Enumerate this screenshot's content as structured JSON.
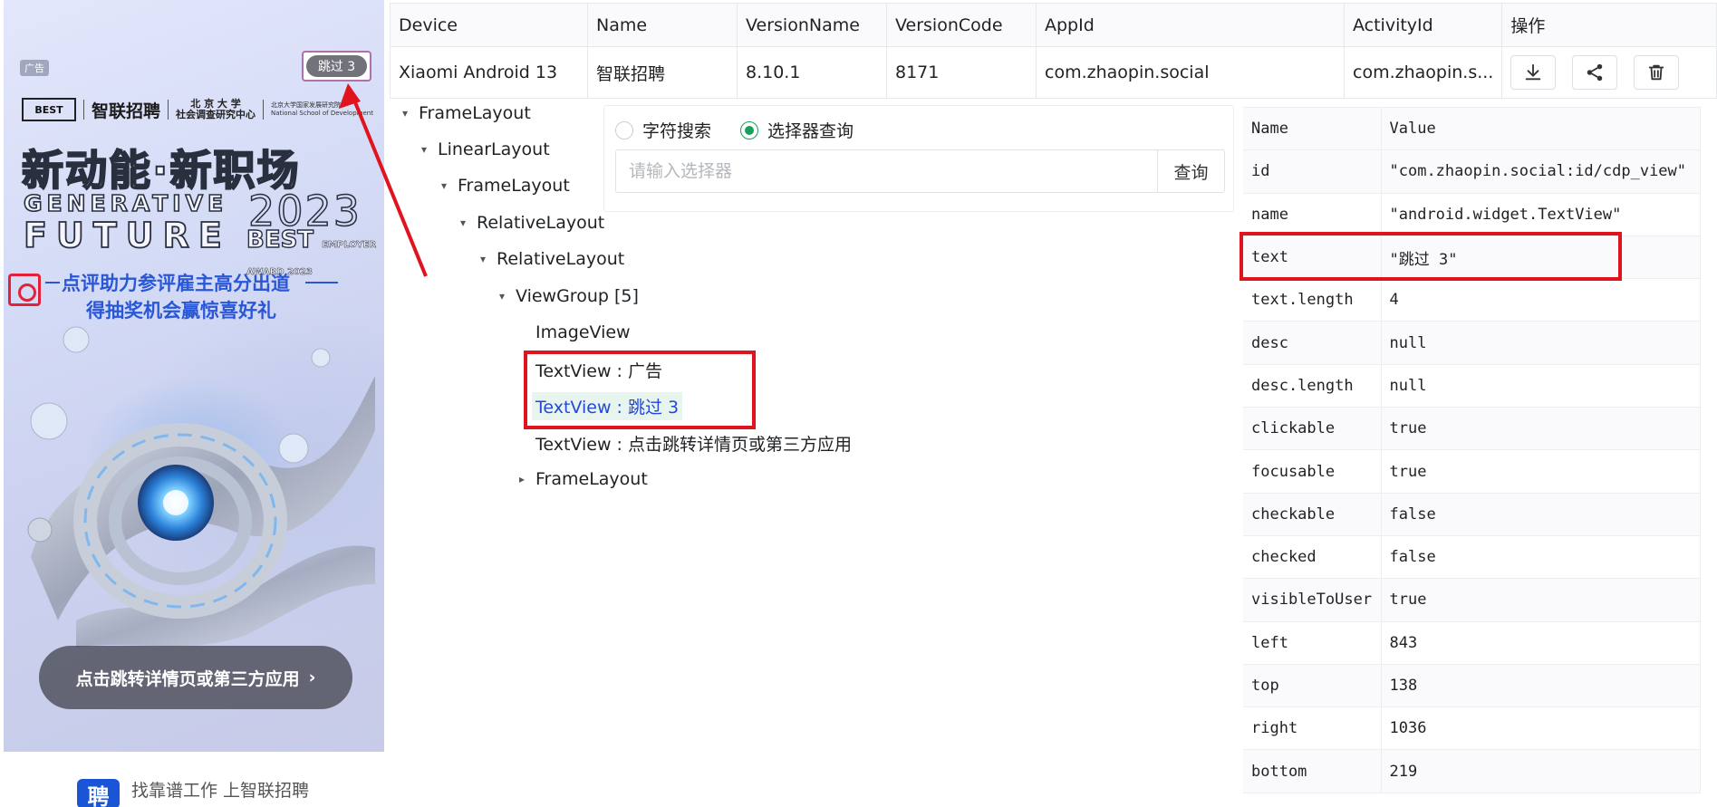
{
  "phone": {
    "ad_tag": "广告",
    "skip_label": "跳过 3",
    "logos": {
      "best": "BEST",
      "zhaopin": "智联招聘",
      "pku_line1": "北 京 大 学",
      "pku_line2": "社会调查研究中心",
      "nsd_line1": "北京大学国家发展研究院",
      "nsd_line2": "National School of Development"
    },
    "headline": "新动能·新职场",
    "line_generative": "GENERATIVE",
    "line_future": "FUTURE",
    "year": "2023",
    "best_award": "BEST",
    "best_award_sub": "EMPLOYER AWARD 2023",
    "promo_line1": "点评助力参评雇主高分出道",
    "promo_line2": "得抽奖机会赢惊喜好礼",
    "cta_label": "点击跳转详情页或第三方应用",
    "cta_arrow": "›",
    "app_icon_char": "聘",
    "slogan": "找靠谱工作  上智联招聘"
  },
  "device_table": {
    "headers": [
      "Device",
      "Name",
      "VersionName",
      "VersionCode",
      "AppId",
      "ActivityId",
      "操作"
    ],
    "row": [
      "Xiaomi Android 13",
      "智联招聘",
      "8.10.1",
      "8171",
      "com.zhaopin.social",
      "com.zhaopin.s..."
    ],
    "icons": [
      "download-icon",
      "share-icon",
      "trash-icon"
    ]
  },
  "tree": {
    "nodes": [
      {
        "label": "FrameLayout",
        "caret": "▾"
      },
      {
        "label": "LinearLayout",
        "caret": "▾"
      },
      {
        "label": "FrameLayout",
        "caret": "▾"
      },
      {
        "label": "RelativeLayout",
        "caret": "▾"
      },
      {
        "label": "RelativeLayout",
        "caret": "▾"
      },
      {
        "label": "ViewGroup [5]",
        "caret": "▾"
      },
      {
        "label": "ImageView",
        "caret": ""
      },
      {
        "label": "TextView : 广告",
        "caret": ""
      },
      {
        "label": "TextView : 跳过 3",
        "caret": ""
      },
      {
        "label": "TextView : 点击跳转详情页或第三方应用",
        "caret": ""
      },
      {
        "label": "FrameLayout",
        "caret": "▸"
      }
    ]
  },
  "search": {
    "option_text": "字符搜索",
    "option_selector": "选择器查询",
    "selected": "选择器查询",
    "placeholder": "请输入选择器",
    "value": "",
    "query_label": "查询"
  },
  "props": {
    "headers": [
      "Name",
      "Value"
    ],
    "rows": [
      [
        "id",
        "\"com.zhaopin.social:id/cdp_view\""
      ],
      [
        "name",
        "\"android.widget.TextView\""
      ],
      [
        "text",
        "\"跳过 3\""
      ],
      [
        "text.length",
        "4"
      ],
      [
        "desc",
        "null"
      ],
      [
        "desc.length",
        "null"
      ],
      [
        "clickable",
        "true"
      ],
      [
        "focusable",
        "true"
      ],
      [
        "checkable",
        "false"
      ],
      [
        "checked",
        "false"
      ],
      [
        "visibleToUser",
        "true"
      ],
      [
        "left",
        "843"
      ],
      [
        "top",
        "138"
      ],
      [
        "right",
        "1036"
      ],
      [
        "bottom",
        "219"
      ]
    ]
  },
  "colors": {
    "highlight": "#e0141e",
    "selected_node_text": "#2448d6",
    "selected_node_bg": "#e7f5ee",
    "radio_active": "#18a058",
    "promo_blue": "#2957d6"
  }
}
